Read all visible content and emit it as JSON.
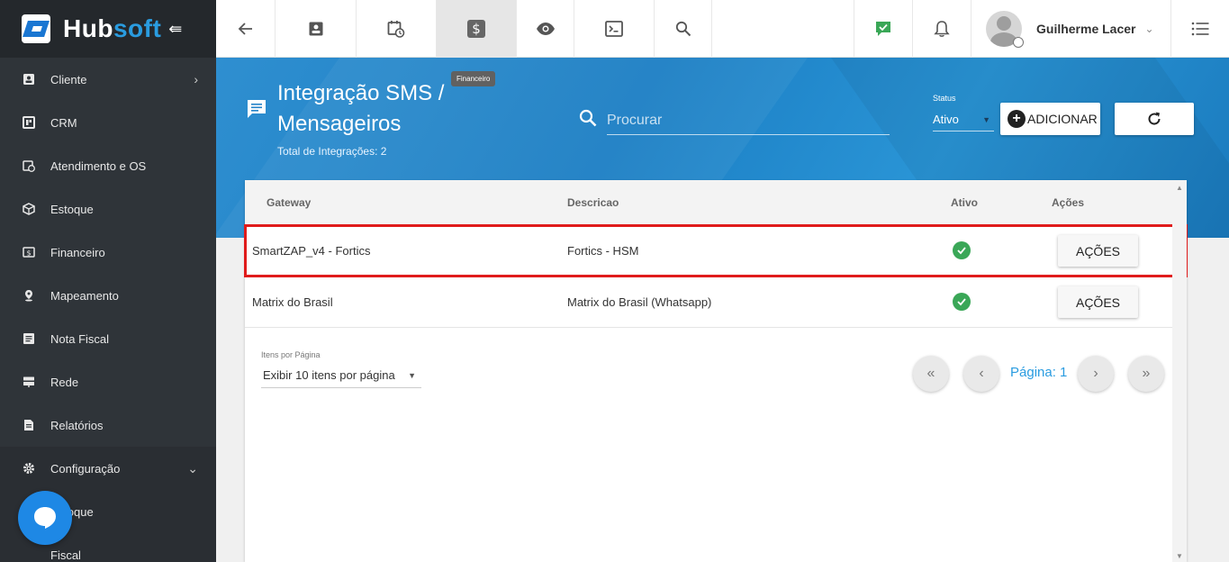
{
  "brand": {
    "name_part1": "Hub",
    "name_part2": "soft"
  },
  "sidebar": {
    "items": [
      {
        "label": "Cliente"
      },
      {
        "label": "CRM"
      },
      {
        "label": "Atendimento e OS"
      },
      {
        "label": "Estoque"
      },
      {
        "label": "Financeiro"
      },
      {
        "label": "Mapeamento"
      },
      {
        "label": "Nota Fiscal"
      },
      {
        "label": "Rede"
      },
      {
        "label": "Relatórios"
      },
      {
        "label": "Configuração"
      }
    ],
    "sub_items": [
      {
        "label": "Estoque"
      },
      {
        "label": "Fiscal"
      }
    ]
  },
  "topbar": {
    "user_name": "Guilherme Lacer",
    "tooltip": "Financeiro"
  },
  "header": {
    "title": "Integração SMS / Mensageiros",
    "subtitle": "Total de Integrações: 2",
    "search_placeholder": "Procurar",
    "status_label": "Status",
    "status_value": "Ativo",
    "add_label": "ADICIONAR"
  },
  "table": {
    "columns": [
      "Gateway",
      "Descricao",
      "Ativo",
      "Ações"
    ],
    "rows": [
      {
        "gateway": "SmartZAP_v4 - Fortics",
        "descricao": "Fortics - HSM",
        "acoes": "AÇÕES"
      },
      {
        "gateway": "Matrix do Brasil",
        "descricao": "Matrix do Brasil (Whatsapp)",
        "acoes": "AÇÕES"
      }
    ]
  },
  "pagination": {
    "items_label": "Itens por Página",
    "items_value": "Exibir 10 itens por página",
    "page_label": "Página: 1"
  },
  "colors": {
    "accent": "#2a9ce0",
    "sidebar": "#2f3439",
    "highlight": "#e01b1b",
    "active_check": "#3aa757"
  }
}
